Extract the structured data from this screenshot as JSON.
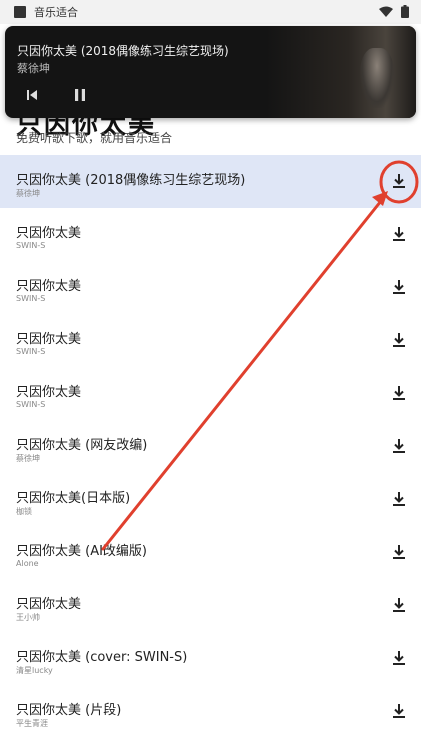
{
  "status_bar": {
    "app_title": "音乐适合",
    "icons": [
      "wifi-icon",
      "battery-icon"
    ]
  },
  "page": {
    "heading": "只因你太美",
    "subtitle": "免费听歌下歌，就用音乐适合"
  },
  "media": {
    "title": "只因你太美 (2018偶像练习生综艺现场)",
    "artist": "蔡徐坤",
    "controls": [
      "previous-icon",
      "pause-icon"
    ]
  },
  "songs": [
    {
      "title": "只因你太美 (2018偶像练习生综艺现场)",
      "artist": "蔡徐坤",
      "selected": true
    },
    {
      "title": "只因你太美",
      "artist": "SWIN-S"
    },
    {
      "title": "只因你太美",
      "artist": "SWIN-S"
    },
    {
      "title": "只因你太美",
      "artist": "SWIN-S"
    },
    {
      "title": "只因你太美",
      "artist": "SWIN-S"
    },
    {
      "title": "只因你太美 (网友改编)",
      "artist": "蔡徐坤"
    },
    {
      "title": "只因你太美(日本版)",
      "artist": "枷锁"
    },
    {
      "title": "只因你太美 (AI改编版)",
      "artist": "Alone"
    },
    {
      "title": "只因你太美",
      "artist": "王小帅"
    },
    {
      "title": "只因你太美 (cover: SWIN-S)",
      "artist": "清星lucky"
    },
    {
      "title": "只因你太美 (片段)",
      "artist": "平生青涯"
    }
  ],
  "colors": {
    "selected_row": "#dfe6f6",
    "annotation": "#e0402e",
    "media_bg": "#141414"
  }
}
